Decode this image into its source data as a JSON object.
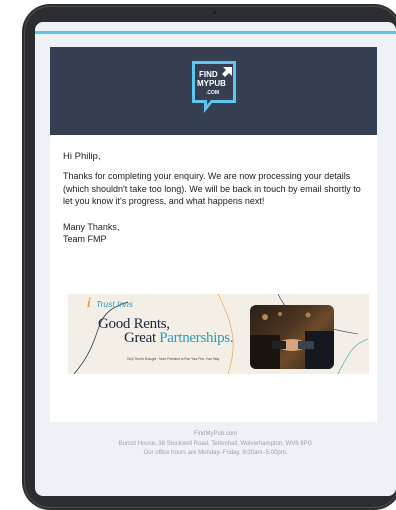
{
  "email": {
    "logo": {
      "line1": "FIND",
      "line2": "MYPUB",
      "line3": ".COM"
    },
    "greeting": "Hi Philip,",
    "paragraph": "Thanks for completing your enquiry. We are now processing your details (which shouldn't take too long). We will be back in touch by email shortly to let you know it's progress, and what happens next!",
    "signoff_line1": "Many Thanks,",
    "signoff_line2": "Team FMP"
  },
  "banner": {
    "brand_i": "i",
    "brand_text": "Trust Inns",
    "headline1": "Good Rents,",
    "headline2_prefix": "Great ",
    "headline2_accent": "Partnerships.",
    "tagline": "Only Tied to Draught · More Freedom to Run Your Pub, Your Way"
  },
  "footer": {
    "line1": "FindMyPub.com",
    "line2": "Burcot House, 38 Stockwell Road, Tettenhall, Wolverhampton, WV6 9PG",
    "line3": "Our office hours are Monday–Friday, 9:00am–5:00pm."
  },
  "colors": {
    "header_bg": "#353f51",
    "accent_blue": "#5ec5ef",
    "device": "#2b2d31"
  },
  "icons": [
    "findmypub-logo-icon",
    "arrow-icon",
    "handshake-photo"
  ]
}
